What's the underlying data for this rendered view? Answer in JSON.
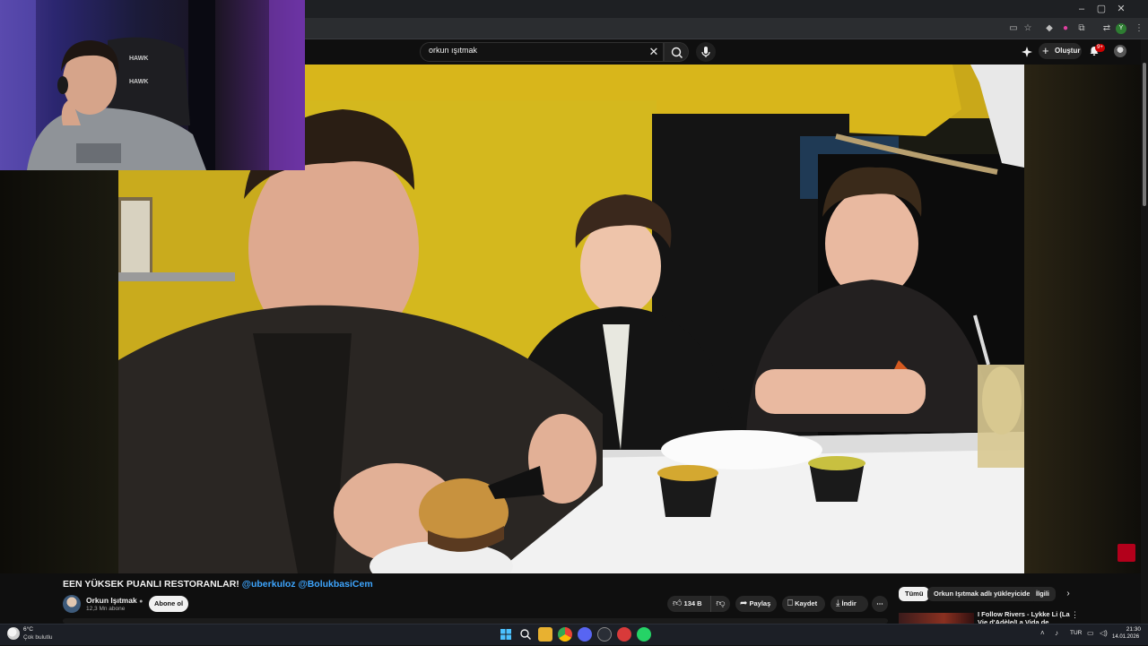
{
  "browser": {
    "window_controls": [
      "–",
      "▢",
      "✕"
    ],
    "extension_badge": "Y"
  },
  "masthead": {
    "search_value": "orkun ışıtmak",
    "create_label": "Oluştur",
    "notification_count": "9+"
  },
  "video": {
    "title_prefix": "EEN YÜKSEK PUANLI RESTORANLAR!",
    "title_mentions": "@uberkuloz @BolukbasiCem"
  },
  "channel": {
    "name": "Orkun Işıtmak",
    "verified_icon": "verified-icon",
    "subscribers": "12,3 Mn abone",
    "subscribe_label": "Abone ol"
  },
  "actions": {
    "like_count": "134 B",
    "share_label": "Paylaş",
    "save_label": "Kaydet",
    "download_label": "İndir",
    "more_label": "⋯"
  },
  "sidebar": {
    "chips": [
      "Tümü",
      "Orkun Işıtmak adlı yükleyiciden",
      "İlgili"
    ],
    "recommendation_title": "I Follow Rivers - Lykke Li (La Vie d'Adèle/La Vida de Adele)"
  },
  "taskbar": {
    "weather_temp": "6°C",
    "weather_desc": "Çok bulutlu",
    "language": "TUR",
    "time": "21:30",
    "date": "14.01.2026"
  },
  "colors": {
    "background": "#0f0f0f",
    "link_blue": "#3ea6ff",
    "notification_red": "#cc0000",
    "wall_yellow": "#d4b81e"
  }
}
